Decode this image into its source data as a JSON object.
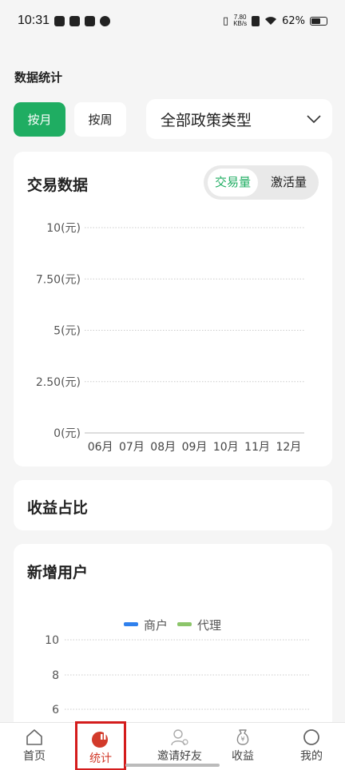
{
  "status_bar": {
    "time": "10:31",
    "netspeed_value": "7.80",
    "netspeed_unit": "KB/s",
    "battery_percent": "62%",
    "battery_level": 0.62
  },
  "page": {
    "section_title": "数据统计"
  },
  "filters": {
    "month_label": "按月",
    "week_label": "按周",
    "selected_period": "month",
    "policy_selected": "全部政策类型"
  },
  "trade_card": {
    "title": "交易数据",
    "toggle": {
      "active": "交易量",
      "inactive": "激活量"
    }
  },
  "profit_card": {
    "title": "收益占比"
  },
  "users_card": {
    "title": "新增用户"
  },
  "tabbar": {
    "items": [
      {
        "label": "首页",
        "icon": "home-icon"
      },
      {
        "label": "统计",
        "icon": "stats-icon"
      },
      {
        "label": "邀请好友",
        "icon": "invite-friend-icon"
      },
      {
        "label": "收益",
        "icon": "money-bag-icon"
      },
      {
        "label": "我的",
        "icon": "profile-icon"
      }
    ],
    "active_index": 1
  },
  "colors": {
    "accent_green": "#1fad62",
    "merchant_blue": "#2f80ed",
    "agent_green": "#8cc56a",
    "active_tab_red": "#d23a2a"
  },
  "chart_data": [
    {
      "type": "bar",
      "title": "交易数据",
      "categories": [
        "06月",
        "07月",
        "08月",
        "09月",
        "10月",
        "11月",
        "12月"
      ],
      "y_ticks": [
        "0(元)",
        "2.50(元)",
        "5(元)",
        "7.50(元)",
        "10(元)"
      ],
      "ylim": [
        0,
        10
      ],
      "values": [
        0,
        0,
        0,
        0,
        0,
        0,
        0
      ],
      "grid": true
    },
    {
      "type": "line",
      "title": "新增用户",
      "series": [
        {
          "name": "商户",
          "color": "#2f80ed",
          "values": []
        },
        {
          "name": "代理",
          "color": "#8cc56a",
          "values": []
        }
      ],
      "y_ticks": [
        "6",
        "8",
        "10"
      ],
      "legend": "top-center",
      "grid": true
    }
  ]
}
